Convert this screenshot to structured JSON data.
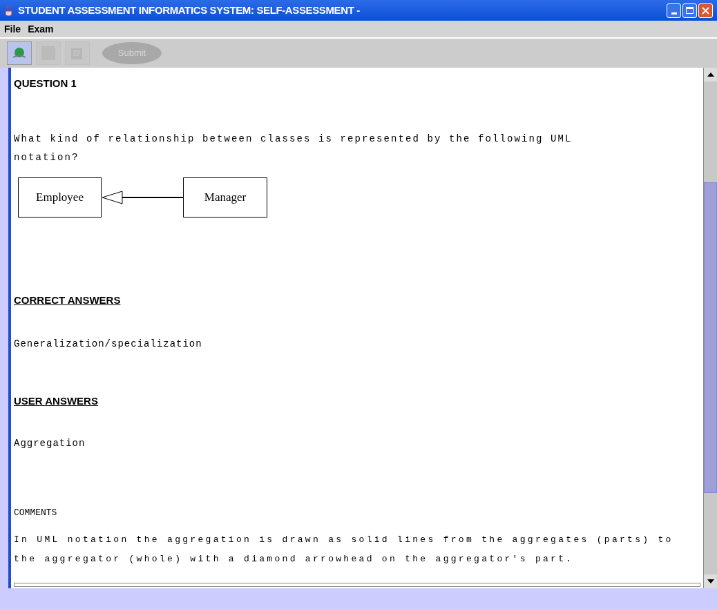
{
  "window": {
    "title": "STUDENT ASSESSMENT INFORMATICS SYSTEM: SELF-ASSESSMENT -"
  },
  "menu": [
    "File",
    "Exam"
  ],
  "toolbar": [
    {
      "kind": "globe",
      "disabled": false
    },
    {
      "kind": "blank",
      "disabled": true
    },
    {
      "kind": "document",
      "disabled": true
    },
    {
      "kind": "submit",
      "label": "Submit",
      "disabled": true
    }
  ],
  "question": {
    "heading": "QUESTION 1",
    "text": "What kind of relationship between classes is represented by the following UML notation?",
    "diagram": {
      "left": "Employee",
      "right": "Manager"
    }
  },
  "correct_answers": {
    "heading": "CORRECT ANSWERS",
    "text": "Generalization/specialization"
  },
  "user_answers": {
    "heading": "USER ANSWERS",
    "text": "Aggregation"
  },
  "comments": {
    "heading": "COMMENTS",
    "text": "In UML notation the aggregation is drawn as solid lines from the aggregates (parts) to the aggregator (whole) with a diamond arrowhead on the aggregator's part."
  }
}
